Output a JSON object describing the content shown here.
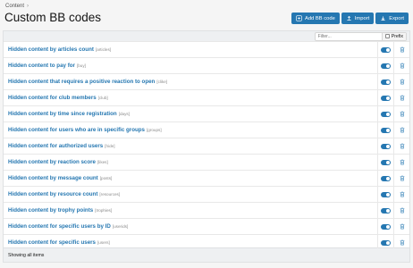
{
  "breadcrumb": {
    "items": [
      "Content"
    ]
  },
  "page": {
    "title": "Custom BB codes"
  },
  "toolbar": {
    "add_label": "Add BB code",
    "import_label": "Import",
    "export_label": "Export"
  },
  "filter": {
    "placeholder": "Filter...",
    "prefix_label": "Prefix"
  },
  "rows": [
    {
      "title": "Hidden content by articles count",
      "tag": "[articles]",
      "enabled": true
    },
    {
      "title": "Hidden content to pay for",
      "tag": "[buy]",
      "enabled": true
    },
    {
      "title": "Hidden content that requires a positive reaction to open",
      "tag": "[clike]",
      "enabled": true
    },
    {
      "title": "Hidden content for club members",
      "tag": "[club]",
      "enabled": true
    },
    {
      "title": "Hidden content by time since registration",
      "tag": "[days]",
      "enabled": true
    },
    {
      "title": "Hidden content for users who are in specific groups",
      "tag": "[groups]",
      "enabled": true
    },
    {
      "title": "Hidden content for authorized users",
      "tag": "[hide]",
      "enabled": true
    },
    {
      "title": "Hidden content by reaction score",
      "tag": "[likes]",
      "enabled": true
    },
    {
      "title": "Hidden content by message count",
      "tag": "[posts]",
      "enabled": true
    },
    {
      "title": "Hidden content by resource count",
      "tag": "[resources]",
      "enabled": true
    },
    {
      "title": "Hidden content by trophy points",
      "tag": "[trophies]",
      "enabled": true
    },
    {
      "title": "Hidden content for specific users by ID",
      "tag": "[userids]",
      "enabled": true
    },
    {
      "title": "Hidden content for specific users",
      "tag": "[users]",
      "enabled": true
    }
  ],
  "footer": {
    "status": "Showing all items"
  },
  "colors": {
    "accent": "#2577b1",
    "link": "#2577b1",
    "tag": "#8c8c8c"
  },
  "icons": {
    "add": "plus-square-icon",
    "import": "upload-icon",
    "export": "download-icon",
    "toggle": "toggle-on-icon",
    "delete": "trash-icon"
  }
}
